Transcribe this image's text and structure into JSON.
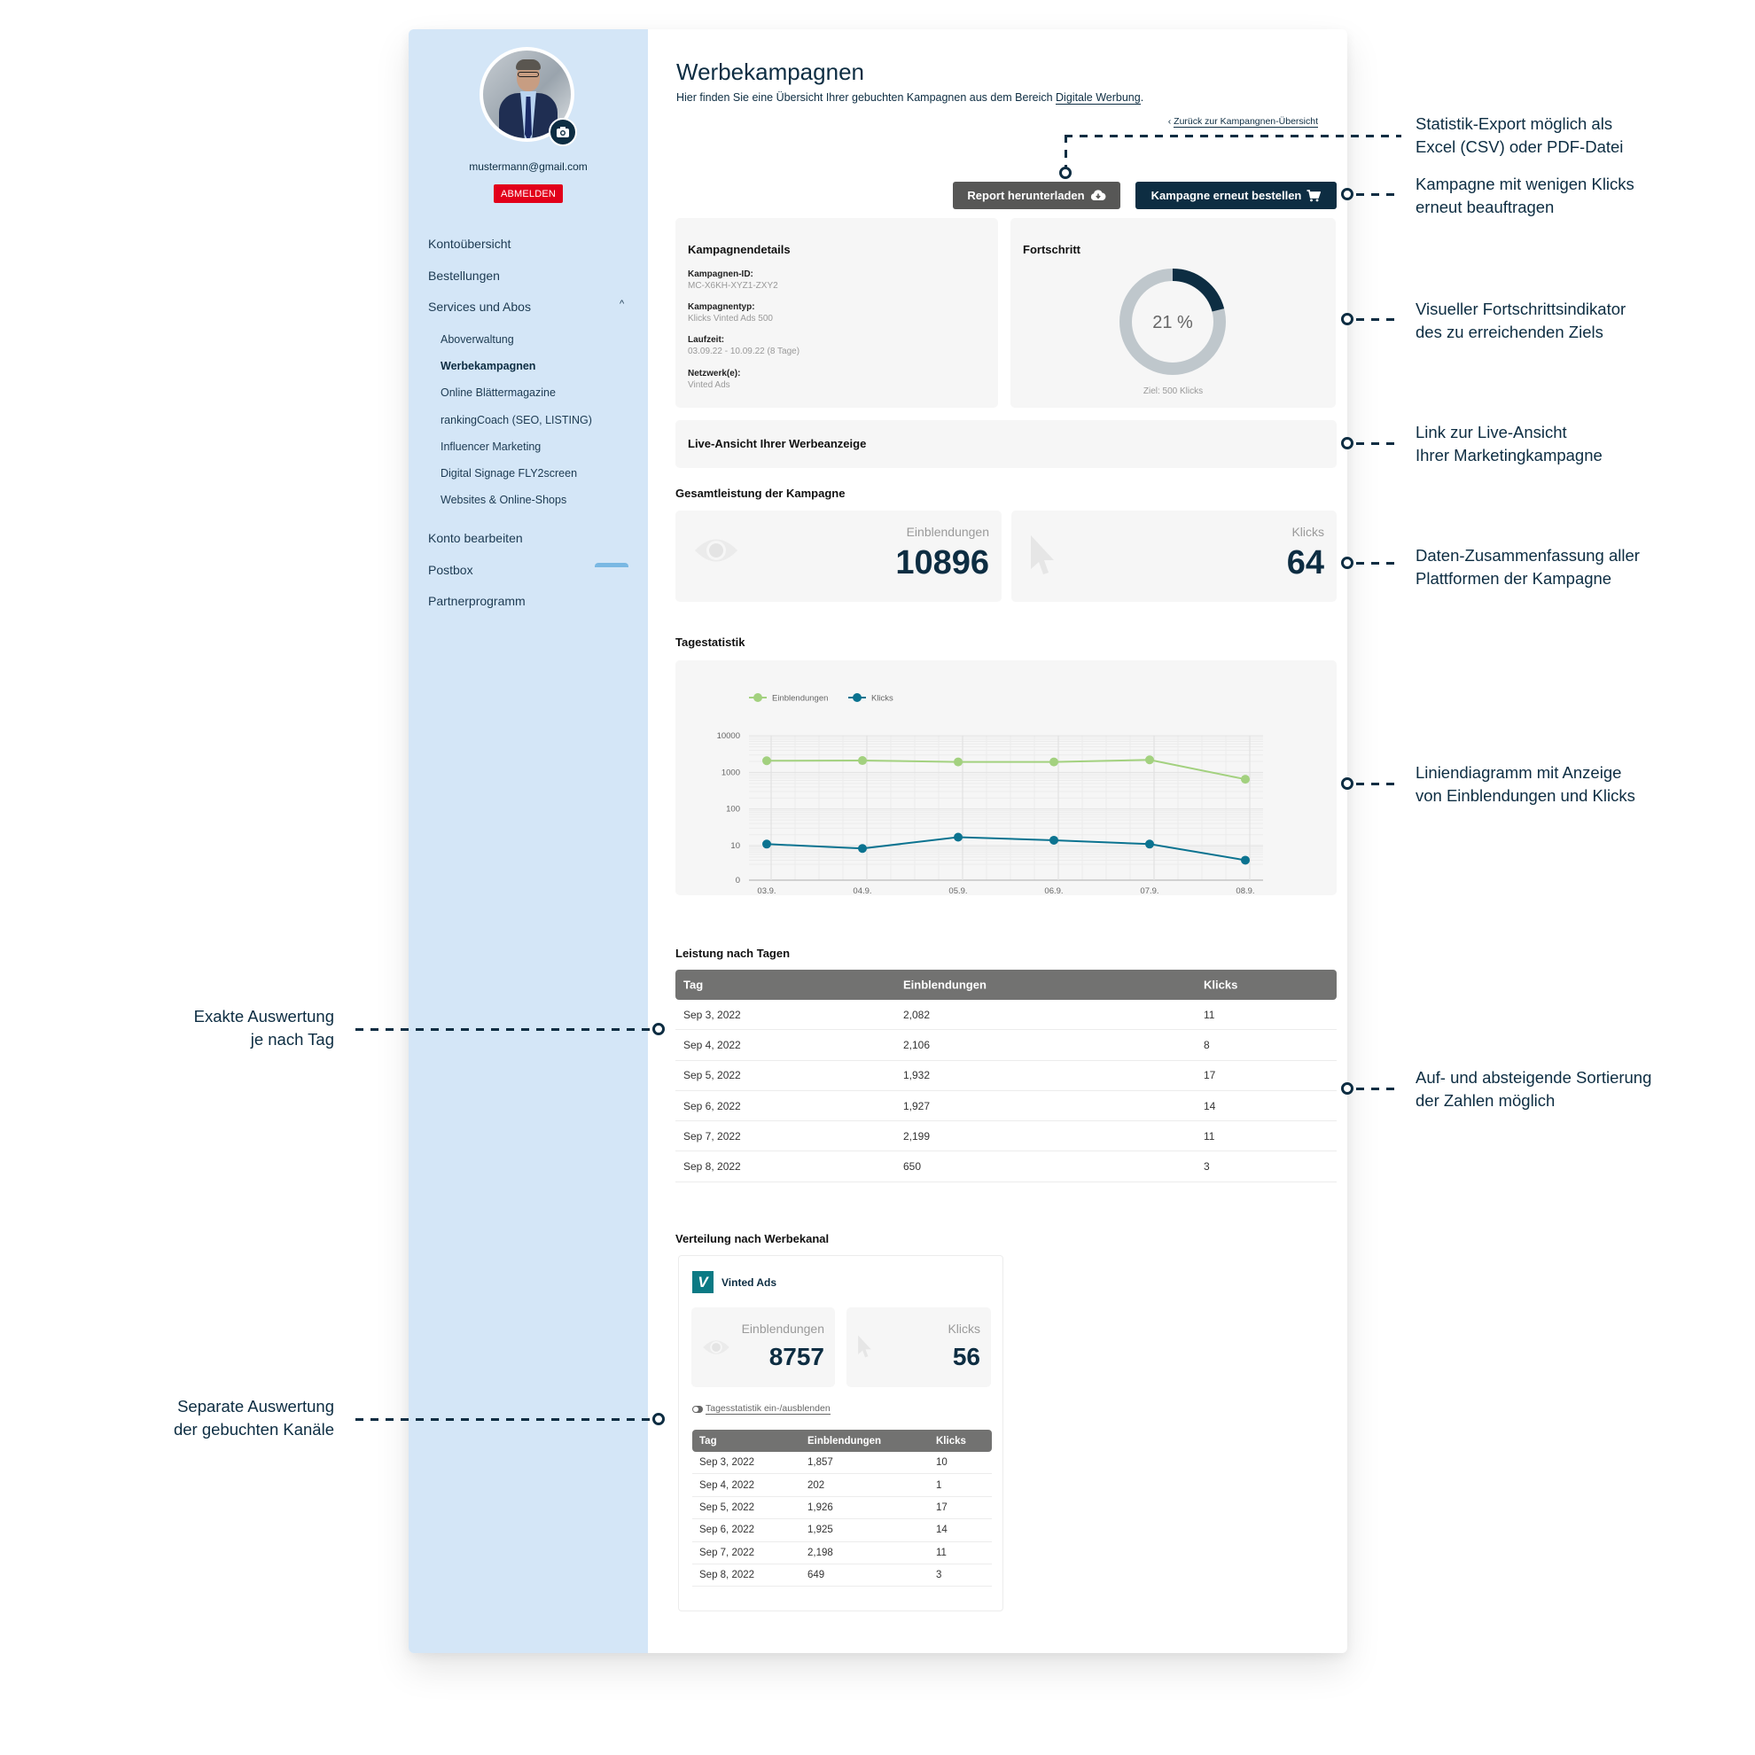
{
  "sidebar": {
    "email": "mustermann@gmail.com",
    "logout_label": "ABMELDEN",
    "items": [
      {
        "label": "Kontoübersicht"
      },
      {
        "label": "Bestellungen"
      },
      {
        "label": "Services und Abos",
        "expanded": true
      },
      {
        "label": "Konto bearbeiten"
      },
      {
        "label": "Postbox"
      },
      {
        "label": "Partnerprogramm"
      }
    ],
    "sub_items": [
      {
        "label": "Aboverwaltung"
      },
      {
        "label": "Werbekampagnen",
        "active": true
      },
      {
        "label": "Online Blättermagazine"
      },
      {
        "label": "rankingCoach (SEO, LISTING)"
      },
      {
        "label": "Influencer Marketing"
      },
      {
        "label": "Digital Signage FLY2screen"
      },
      {
        "label": "Websites & Online-Shops"
      }
    ]
  },
  "header": {
    "title": "Werbekampagnen",
    "subtitle_prefix": "Hier finden Sie eine Übersicht Ihrer gebuchten Kampagnen aus dem Bereich ",
    "subtitle_link": "Digitale Werbung",
    "subtitle_suffix": ".",
    "back_link": "Zurück zur Kampangnen-Übersicht"
  },
  "actions": {
    "report_label": "Report herunterladen",
    "order_label": "Kampagne erneut bestellen"
  },
  "details": {
    "title": "Kampagnendetails",
    "fields": [
      {
        "label": "Kampagnen-ID:",
        "value": "MC-X6KH-XYZ1-ZXY2"
      },
      {
        "label": "Kampagnentyp:",
        "value": "Klicks Vinted Ads 500"
      },
      {
        "label": "Laufzeit:",
        "value": "03.09.22 - 10.09.22 (8 Tage)"
      },
      {
        "label": "Netzwerk(e):",
        "value": "Vinted Ads"
      }
    ]
  },
  "progress": {
    "title": "Fortschritt",
    "percent": 21,
    "percent_label": "21 %",
    "goal_label": "Ziel: 500 Klicks",
    "fill_color": "#0d2d42",
    "track_color": "#bfc7cc"
  },
  "live_view": {
    "label": "Live-Ansicht Ihrer Werbeanzeige"
  },
  "totals": {
    "title": "Gesamtleistung der Kampagne",
    "impressions_label": "Einblendungen",
    "impressions_value": "10896",
    "clicks_label": "Klicks",
    "clicks_value": "64"
  },
  "daily_chart_title": "Tagestatistik",
  "chart_data": {
    "type": "line",
    "title": "Tagestatistik",
    "x": [
      "03.9.",
      "04.9.",
      "05.9.",
      "06.9.",
      "07.9.",
      "08.9."
    ],
    "series": [
      {
        "name": "Einblendungen",
        "color": "#a3d17f",
        "values": [
          2082,
          2106,
          1932,
          1927,
          2199,
          650
        ]
      },
      {
        "name": "Klicks",
        "color": "#0b7390",
        "values": [
          11,
          8,
          17,
          14,
          11,
          3
        ]
      }
    ],
    "yscale": "log",
    "yticks": [
      0,
      10,
      100,
      1000,
      10000
    ],
    "ytick_labels": [
      "0",
      "10",
      "100",
      "1000",
      "10000"
    ],
    "ylim": [
      0,
      10000
    ],
    "xlabel": "",
    "ylabel": "",
    "grid": true,
    "legend": "top-left"
  },
  "daily_table": {
    "title": "Leistung nach Tagen",
    "columns": [
      "Tag",
      "Einblendungen",
      "Klicks"
    ],
    "rows": [
      [
        "Sep 3, 2022",
        "2,082",
        "11"
      ],
      [
        "Sep 4, 2022",
        "2,106",
        "8"
      ],
      [
        "Sep 5, 2022",
        "1,932",
        "17"
      ],
      [
        "Sep 6, 2022",
        "1,927",
        "14"
      ],
      [
        "Sep 7, 2022",
        "2,199",
        "11"
      ],
      [
        "Sep 8, 2022",
        "650",
        "3"
      ]
    ]
  },
  "channels": {
    "title": "Verteilung nach Werbekanal",
    "items": [
      {
        "name": "Vinted Ads",
        "logo_letter": "V",
        "logo_color": "#0b7a84",
        "impressions_label": "Einblendungen",
        "impressions_value": "8757",
        "clicks_label": "Klicks",
        "clicks_value": "56",
        "toggle_label": "Tagesstatistik ein-/ausblenden",
        "columns": [
          "Tag",
          "Einblendungen",
          "Klicks"
        ],
        "rows": [
          [
            "Sep 3, 2022",
            "1,857",
            "10"
          ],
          [
            "Sep 4, 2022",
            "202",
            "1"
          ],
          [
            "Sep 5, 2022",
            "1,926",
            "17"
          ],
          [
            "Sep 6, 2022",
            "1,925",
            "14"
          ],
          [
            "Sep 7, 2022",
            "2,198",
            "11"
          ],
          [
            "Sep 8, 2022",
            "649",
            "3"
          ]
        ]
      }
    ]
  },
  "annotations": {
    "export": [
      "Statistik-Export möglich als",
      "Excel (CSV) oder PDF-Datei"
    ],
    "reorder": [
      "Kampagne mit wenigen Klicks",
      "erneut beauftragen"
    ],
    "progress": [
      "Visueller Fortschrittsindikator",
      "des zu erreichenden Ziels"
    ],
    "live": [
      "Link zur Live-Ansicht",
      "Ihrer Marketingkampagne"
    ],
    "summary": [
      "Daten-Zusammenfassung aller",
      "Plattformen der Kampagne"
    ],
    "chart": [
      "Liniendiagramm mit Anzeige",
      "von Einblendungen und Klicks"
    ],
    "sorting": [
      "Auf- und absteigende Sortierung",
      "der Zahlen möglich"
    ],
    "daily": [
      "Exakte Auswertung",
      "je nach Tag"
    ],
    "channels": [
      "Separate Auswertung",
      "der gebuchten Kanäle"
    ]
  }
}
